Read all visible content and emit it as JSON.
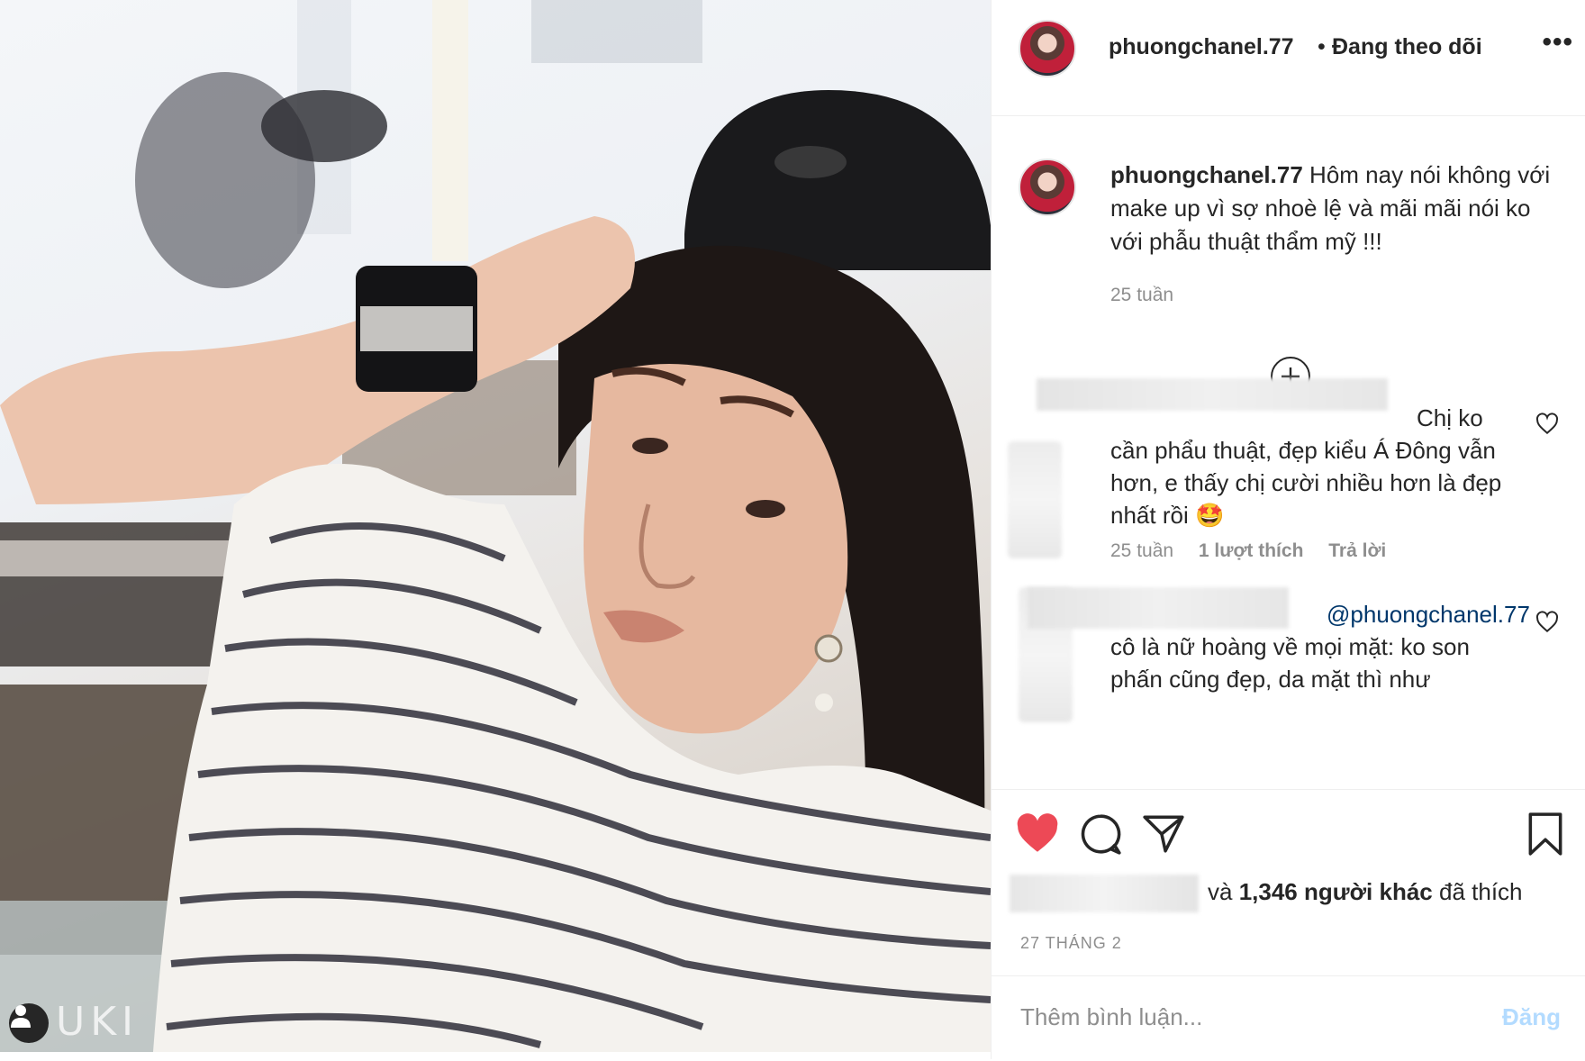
{
  "photo": {
    "watermark": "UKI",
    "user_tag_icon": "person-icon"
  },
  "header": {
    "username": "phuongchanel.77",
    "separator": "•",
    "follow_status": "Đang theo dõi",
    "more_icon": "more-options-icon"
  },
  "caption": {
    "username": "phuongchanel.77",
    "text": " Hôm nay nói không với make up vì sợ nhoè lệ và mãi mãi nói ko với phẫu thuật thẩm mỹ !!!",
    "time": "25 tuần"
  },
  "load_more_icon": "plus-circle-icon",
  "comments": [
    {
      "text": "Chị ko cần phẩu thuật, đẹp kiểu Á Đông vẫn hơn, e thấy chị cười nhiều hơn là đẹp nhất rồi 🤩",
      "time": "25 tuần",
      "likes": "1 lượt thích",
      "reply": "Trả lời"
    },
    {
      "mention": "@phuongchanel.77",
      "text": " cô là nữ hoàng về mọi mặt: ko son phấn cũng đẹp, da mặt thì như"
    }
  ],
  "actions": {
    "like_icon": "heart-filled-icon",
    "comment_icon": "comment-icon",
    "share_icon": "send-icon",
    "save_icon": "bookmark-icon",
    "likes_prefix": "và ",
    "likes_count": "1,346 người khác",
    "likes_suffix": " đã thích",
    "date": "27 THÁNG 2"
  },
  "add_comment": {
    "placeholder": "Thêm bình luận...",
    "post_label": "Đăng"
  },
  "colors": {
    "like": "#ed4956",
    "text": "#262626",
    "muted": "#8e8e8e",
    "link": "#00376b",
    "post_disabled": "#b3dbff"
  }
}
